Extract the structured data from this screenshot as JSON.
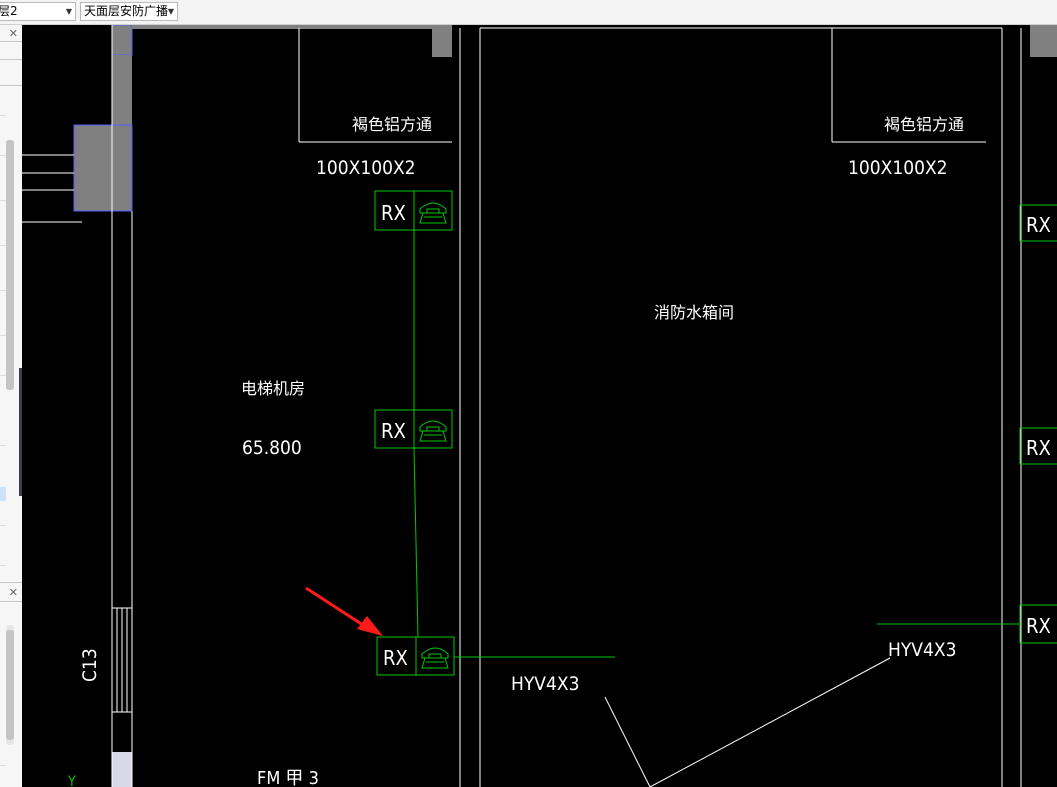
{
  "toolbar": {
    "layer_combo_value": "层2",
    "view_combo_value": "天面层安防广播"
  },
  "drawing": {
    "rooms": {
      "elevator_room_name": "电梯机房",
      "elevator_room_elevation": "65.800",
      "fire_tank_room_name": "消防水箱间"
    },
    "labels": {
      "material_left": "褐色铝方通",
      "size_left": "100X100X2",
      "material_right": "褐色铝方通",
      "size_right": "100X100X2",
      "cable_left": "HYV4X3",
      "cable_right": "HYV4X3",
      "column_ref": "C13",
      "door_ref": "FM 甲 3",
      "axis_y": "Y"
    },
    "device_label": "RX",
    "colors": {
      "background": "#000000",
      "wall_line": "#ffffff",
      "device_green": "#00c800",
      "column_gray": "#808080",
      "arrow_red": "#ff1a1a"
    }
  }
}
